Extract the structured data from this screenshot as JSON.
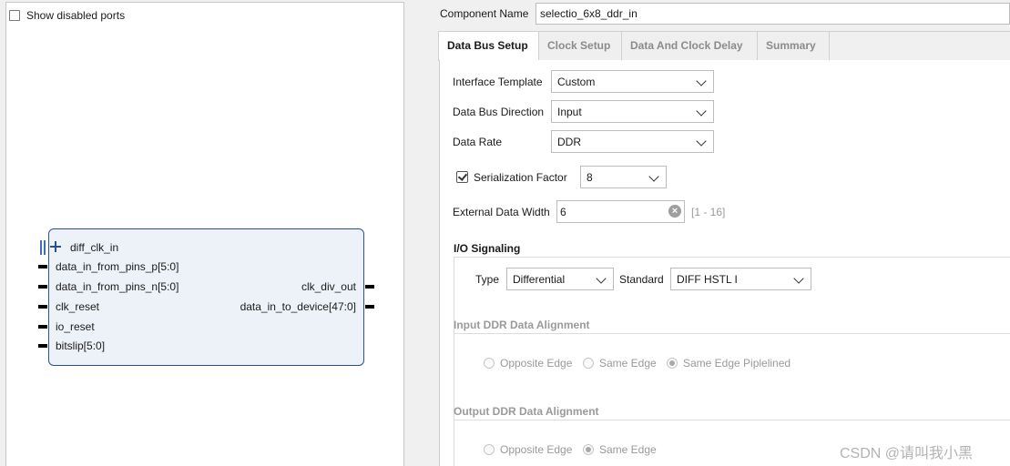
{
  "left": {
    "show_disabled_ports": "Show disabled ports",
    "ports_in": [
      "diff_clk_in",
      "data_in_from_pins_p[5:0]",
      "data_in_from_pins_n[5:0]",
      "clk_reset",
      "io_reset",
      "bitslip[5:0]"
    ],
    "ports_out": [
      "clk_div_out",
      "data_in_to_device[47:0]"
    ]
  },
  "header": {
    "component_name_label": "Component Name",
    "component_name_value": "selectio_6x8_ddr_in"
  },
  "tabs": [
    "Data Bus Setup",
    "Clock Setup",
    "Data And Clock Delay",
    "Summary"
  ],
  "form": {
    "interface_template_label": "Interface Template",
    "interface_template_value": "Custom",
    "data_bus_direction_label": "Data Bus Direction",
    "data_bus_direction_value": "Input",
    "data_rate_label": "Data Rate",
    "data_rate_value": "DDR",
    "serialization_factor_label": "Serialization Factor",
    "serialization_factor_value": "8",
    "external_data_width_label": "External Data Width",
    "external_data_width_value": "6",
    "external_data_width_range": "[1 - 16]"
  },
  "io_signaling": {
    "title": "I/O Signaling",
    "type_label": "Type",
    "type_value": "Differential",
    "standard_label": "Standard",
    "standard_value": "DIFF HSTL I"
  },
  "input_ddr": {
    "title": "Input DDR Data Alignment",
    "options": [
      "Opposite Edge",
      "Same Edge",
      "Same Edge Piplelined"
    ]
  },
  "output_ddr": {
    "title": "Output DDR Data Alignment",
    "options": [
      "Opposite Edge",
      "Same Edge"
    ]
  },
  "watermark": "CSDN @请叫我小黑"
}
